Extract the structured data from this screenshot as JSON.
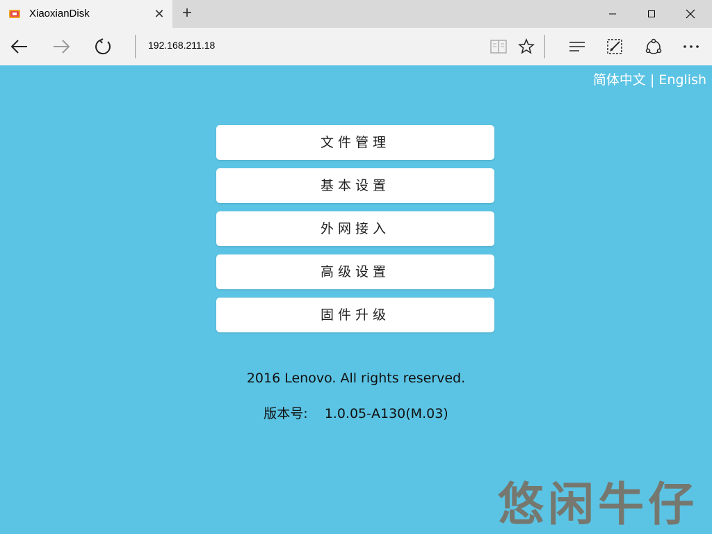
{
  "browser": {
    "tab_title": "XiaoxianDisk",
    "url": "192.168.211.18",
    "icons": [
      "favicon-icon",
      "close-icon",
      "plus-icon",
      "minimize-icon",
      "maximize-icon",
      "close-window-icon",
      "back-icon",
      "forward-icon",
      "refresh-icon",
      "reading-view-icon",
      "favorite-star-icon",
      "hub-icon",
      "web-note-icon",
      "share-icon",
      "more-icon"
    ]
  },
  "lang": {
    "chinese": "简体中文",
    "divider": "|",
    "english": "English"
  },
  "menu": {
    "items": [
      {
        "label": "文件管理"
      },
      {
        "label": "基本设置"
      },
      {
        "label": "外网接入"
      },
      {
        "label": "高级设置"
      },
      {
        "label": "固件升级"
      }
    ]
  },
  "footer": {
    "copyright": "2016 Lenovo. All rights reserved.",
    "version_label": "版本号:",
    "version_value": "1.0.05-A130(M.03)"
  },
  "watermark": {
    "text": "悠闲牛仔"
  },
  "colors": {
    "page_bg": "#5bc3e3",
    "button_bg": "#ffffff",
    "chrome_bg": "#f2f2f2"
  }
}
